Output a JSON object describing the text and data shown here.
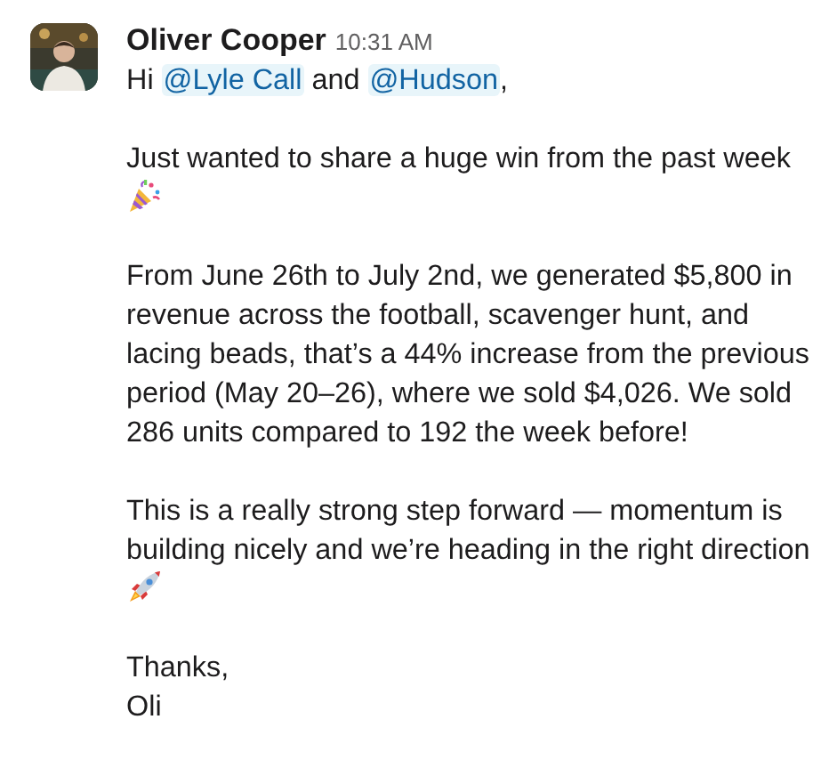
{
  "message": {
    "author": "Oliver Cooper",
    "time": "10:31 AM",
    "paragraphs": [
      [
        {
          "kind": "text",
          "text": "Hi "
        },
        {
          "kind": "mention",
          "text": "@Lyle Call"
        },
        {
          "kind": "text",
          "text": " and "
        },
        {
          "kind": "mention",
          "text": "@Hudson"
        },
        {
          "kind": "text",
          "text": ","
        }
      ],
      [
        {
          "kind": "text",
          "text": "Just wanted to share a huge win from the past week "
        },
        {
          "kind": "party"
        }
      ],
      [
        {
          "kind": "text",
          "text": "From June 26th to July 2nd, we generated $5,800 in revenue across the football, scavenger hunt, and lacing beads, that’s a 44% increase from the previous period (May 20–26), where we sold $4,026. We sold 286 units compared to 192 the week before!"
        }
      ],
      [
        {
          "kind": "text",
          "text": "This is a really strong step forward — momentum is building nicely and we’re heading in the right direction "
        },
        {
          "kind": "rocket"
        }
      ],
      [
        {
          "kind": "text",
          "text": "Thanks,\nOli"
        }
      ]
    ]
  }
}
